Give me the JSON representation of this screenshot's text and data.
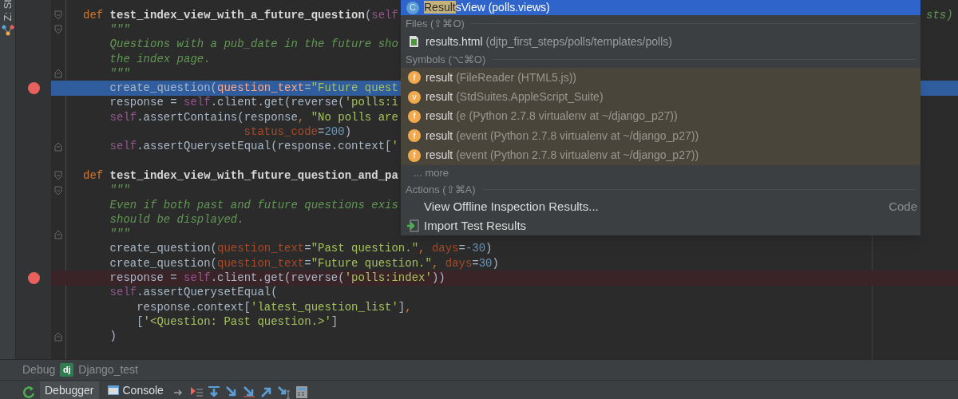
{
  "tool_stripe": {
    "label": "Z: St"
  },
  "editor": {
    "lines": [
      {
        "fold": {
          "kind": "start"
        },
        "breakpoint": false,
        "current": false,
        "tokens": [
          {
            "kind": "keyword",
            "text": "def "
          },
          {
            "kind": "name",
            "text": "test_index_view_with_a_future_question"
          },
          {
            "kind": "plain",
            "text": "("
          },
          {
            "kind": "self",
            "text": "self"
          }
        ]
      },
      {
        "fold": {
          "kind": "start"
        },
        "breakpoint": false,
        "current": false,
        "tokens": [
          {
            "kind": "doc",
            "text": "    \"\"\""
          }
        ]
      },
      {
        "breakpoint": false,
        "current": false,
        "tokens": [
          {
            "kind": "doc",
            "text": "    Questions with a pub_date in the future sho"
          }
        ]
      },
      {
        "breakpoint": false,
        "current": false,
        "tokens": [
          {
            "kind": "doc",
            "text": "    the index page."
          }
        ]
      },
      {
        "fold": {
          "kind": "end"
        },
        "breakpoint": false,
        "current": false,
        "tokens": [
          {
            "kind": "doc",
            "text": "    \"\"\""
          }
        ]
      },
      {
        "breakpoint": true,
        "current": true,
        "tokens": [
          {
            "kind": "plain",
            "text": "    create_question("
          },
          {
            "kind": "param",
            "text": "question_text"
          },
          {
            "kind": "plain",
            "text": "="
          },
          {
            "kind": "string",
            "text": "\"Future quest"
          }
        ]
      },
      {
        "breakpoint": false,
        "current": false,
        "tokens": [
          {
            "kind": "plain",
            "text": "    response = "
          },
          {
            "kind": "self",
            "text": "self"
          },
          {
            "kind": "plain",
            "text": ".client.get(reverse("
          },
          {
            "kind": "string",
            "text": "'polls:i"
          }
        ]
      },
      {
        "breakpoint": false,
        "current": false,
        "tokens": [
          {
            "kind": "self",
            "text": "    self"
          },
          {
            "kind": "plain",
            "text": ".assertContains(response"
          },
          {
            "kind": "keyword",
            "text": ", "
          },
          {
            "kind": "string",
            "text": "\"No polls are"
          }
        ]
      },
      {
        "breakpoint": false,
        "current": false,
        "tokens": [
          {
            "kind": "param",
            "text": "                        status_code"
          },
          {
            "kind": "plain",
            "text": "="
          },
          {
            "kind": "number",
            "text": "200"
          },
          {
            "kind": "plain",
            "text": ")"
          }
        ]
      },
      {
        "fold": {
          "kind": "end"
        },
        "breakpoint": false,
        "current": false,
        "tokens": [
          {
            "kind": "self",
            "text": "    self"
          },
          {
            "kind": "plain",
            "text": ".assertQuerysetEqual(response.context["
          },
          {
            "kind": "string",
            "text": "'"
          }
        ]
      },
      {
        "breakpoint": false,
        "current": false
      },
      {
        "fold": {
          "kind": "start"
        },
        "breakpoint": false,
        "current": false,
        "tokens": [
          {
            "kind": "keyword",
            "text": "def "
          },
          {
            "kind": "name",
            "text": "test_index_view_with_future_question_and_pa"
          }
        ]
      },
      {
        "fold": {
          "kind": "start"
        },
        "breakpoint": false,
        "current": false,
        "tokens": [
          {
            "kind": "doc",
            "text": "    \"\"\""
          }
        ]
      },
      {
        "breakpoint": false,
        "current": false,
        "tokens": [
          {
            "kind": "doc",
            "text": "    Even if both past and future questions exis"
          }
        ]
      },
      {
        "breakpoint": false,
        "current": false,
        "tokens": [
          {
            "kind": "doc",
            "text": "    should be displayed."
          }
        ]
      },
      {
        "fold": {
          "kind": "end"
        },
        "breakpoint": false,
        "current": false,
        "tokens": [
          {
            "kind": "doc",
            "text": "    \"\"\""
          }
        ]
      },
      {
        "breakpoint": false,
        "current": false,
        "tokens": [
          {
            "kind": "plain",
            "text": "    create_question("
          },
          {
            "kind": "param",
            "text": "question_text"
          },
          {
            "kind": "plain",
            "text": "="
          },
          {
            "kind": "string",
            "text": "\"Past question.\""
          },
          {
            "kind": "keyword",
            "text": ", "
          },
          {
            "kind": "param",
            "text": "days"
          },
          {
            "kind": "plain",
            "text": "="
          },
          {
            "kind": "number",
            "text": "-30"
          },
          {
            "kind": "plain",
            "text": ")"
          }
        ]
      },
      {
        "breakpoint": false,
        "current": false,
        "tokens": [
          {
            "kind": "plain",
            "text": "    create_question("
          },
          {
            "kind": "param",
            "text": "question_text"
          },
          {
            "kind": "plain",
            "text": "="
          },
          {
            "kind": "string",
            "text": "\"Future question.\""
          },
          {
            "kind": "keyword",
            "text": ", "
          },
          {
            "kind": "param",
            "text": "days"
          },
          {
            "kind": "plain",
            "text": "="
          },
          {
            "kind": "number",
            "text": "30"
          },
          {
            "kind": "plain",
            "text": ")"
          }
        ]
      },
      {
        "breakpoint": true,
        "current": false,
        "tokens": [
          {
            "kind": "plain",
            "text": "    response = "
          },
          {
            "kind": "self",
            "text": "self"
          },
          {
            "kind": "plain",
            "text": ".client.get(reverse("
          },
          {
            "kind": "string",
            "text": "'polls:index'"
          },
          {
            "kind": "plain",
            "text": "))"
          }
        ]
      },
      {
        "breakpoint": false,
        "current": false,
        "tokens": [
          {
            "kind": "self",
            "text": "    self"
          },
          {
            "kind": "plain",
            "text": ".assertQuerysetEqual("
          }
        ]
      },
      {
        "breakpoint": false,
        "current": false,
        "tokens": [
          {
            "kind": "plain",
            "text": "        response.context["
          },
          {
            "kind": "string",
            "text": "'latest_question_list'"
          },
          {
            "kind": "plain",
            "text": "]"
          },
          {
            "kind": "keyword",
            "text": ","
          }
        ]
      },
      {
        "breakpoint": false,
        "current": false,
        "tokens": [
          {
            "kind": "plain",
            "text": "        ["
          },
          {
            "kind": "string",
            "text": "'<Question: Past question.>'"
          },
          {
            "kind": "plain",
            "text": "]"
          }
        ]
      },
      {
        "fold": {
          "kind": "end"
        },
        "breakpoint": false,
        "current": false,
        "tokens": [
          {
            "kind": "plain",
            "text": "    )"
          }
        ]
      }
    ],
    "right_fragment": "sts)"
  },
  "popup": {
    "top_item": {
      "match": "Result",
      "rest": "sView",
      "location": "(polls.views)",
      "icon": "C",
      "selected": true
    },
    "files_header": "Files (⇧⌘O)",
    "files": [
      {
        "name": "results.html",
        "location": "(djtp_first_steps/polls/templates/polls)"
      }
    ],
    "symbols_header": "Symbols (⌥⌘O)",
    "symbols": [
      {
        "icon": "f",
        "name": "result",
        "location": "(FileReader (HTML5.js))"
      },
      {
        "icon": "v",
        "name": "result",
        "location": "(StdSuites.AppleScript_Suite)"
      },
      {
        "icon": "f",
        "name": "result",
        "location": "(e (Python 2.7.8 virtualenv at ~/django_p27))"
      },
      {
        "icon": "f",
        "name": "result",
        "location": "(event (Python 2.7.8 virtualenv at ~/django_p27))"
      },
      {
        "icon": "f",
        "name": "result",
        "location": "(event (Python 2.7.8 virtualenv at ~/django_p27))"
      }
    ],
    "more": "... more",
    "actions_header": "Actions (⇧⌘A)",
    "actions": [
      {
        "kind": "plain",
        "label": "View Offline Inspection Results...",
        "shortcut": "Code"
      },
      {
        "kind": "import",
        "label": "Import Test Results"
      }
    ]
  },
  "debug_panel": {
    "label": "Debug",
    "config_badge": "dj",
    "config": "Django_test",
    "tabs": [
      {
        "label": "Debugger",
        "selected": true
      },
      {
        "label": "Console",
        "selected": false
      }
    ]
  }
}
